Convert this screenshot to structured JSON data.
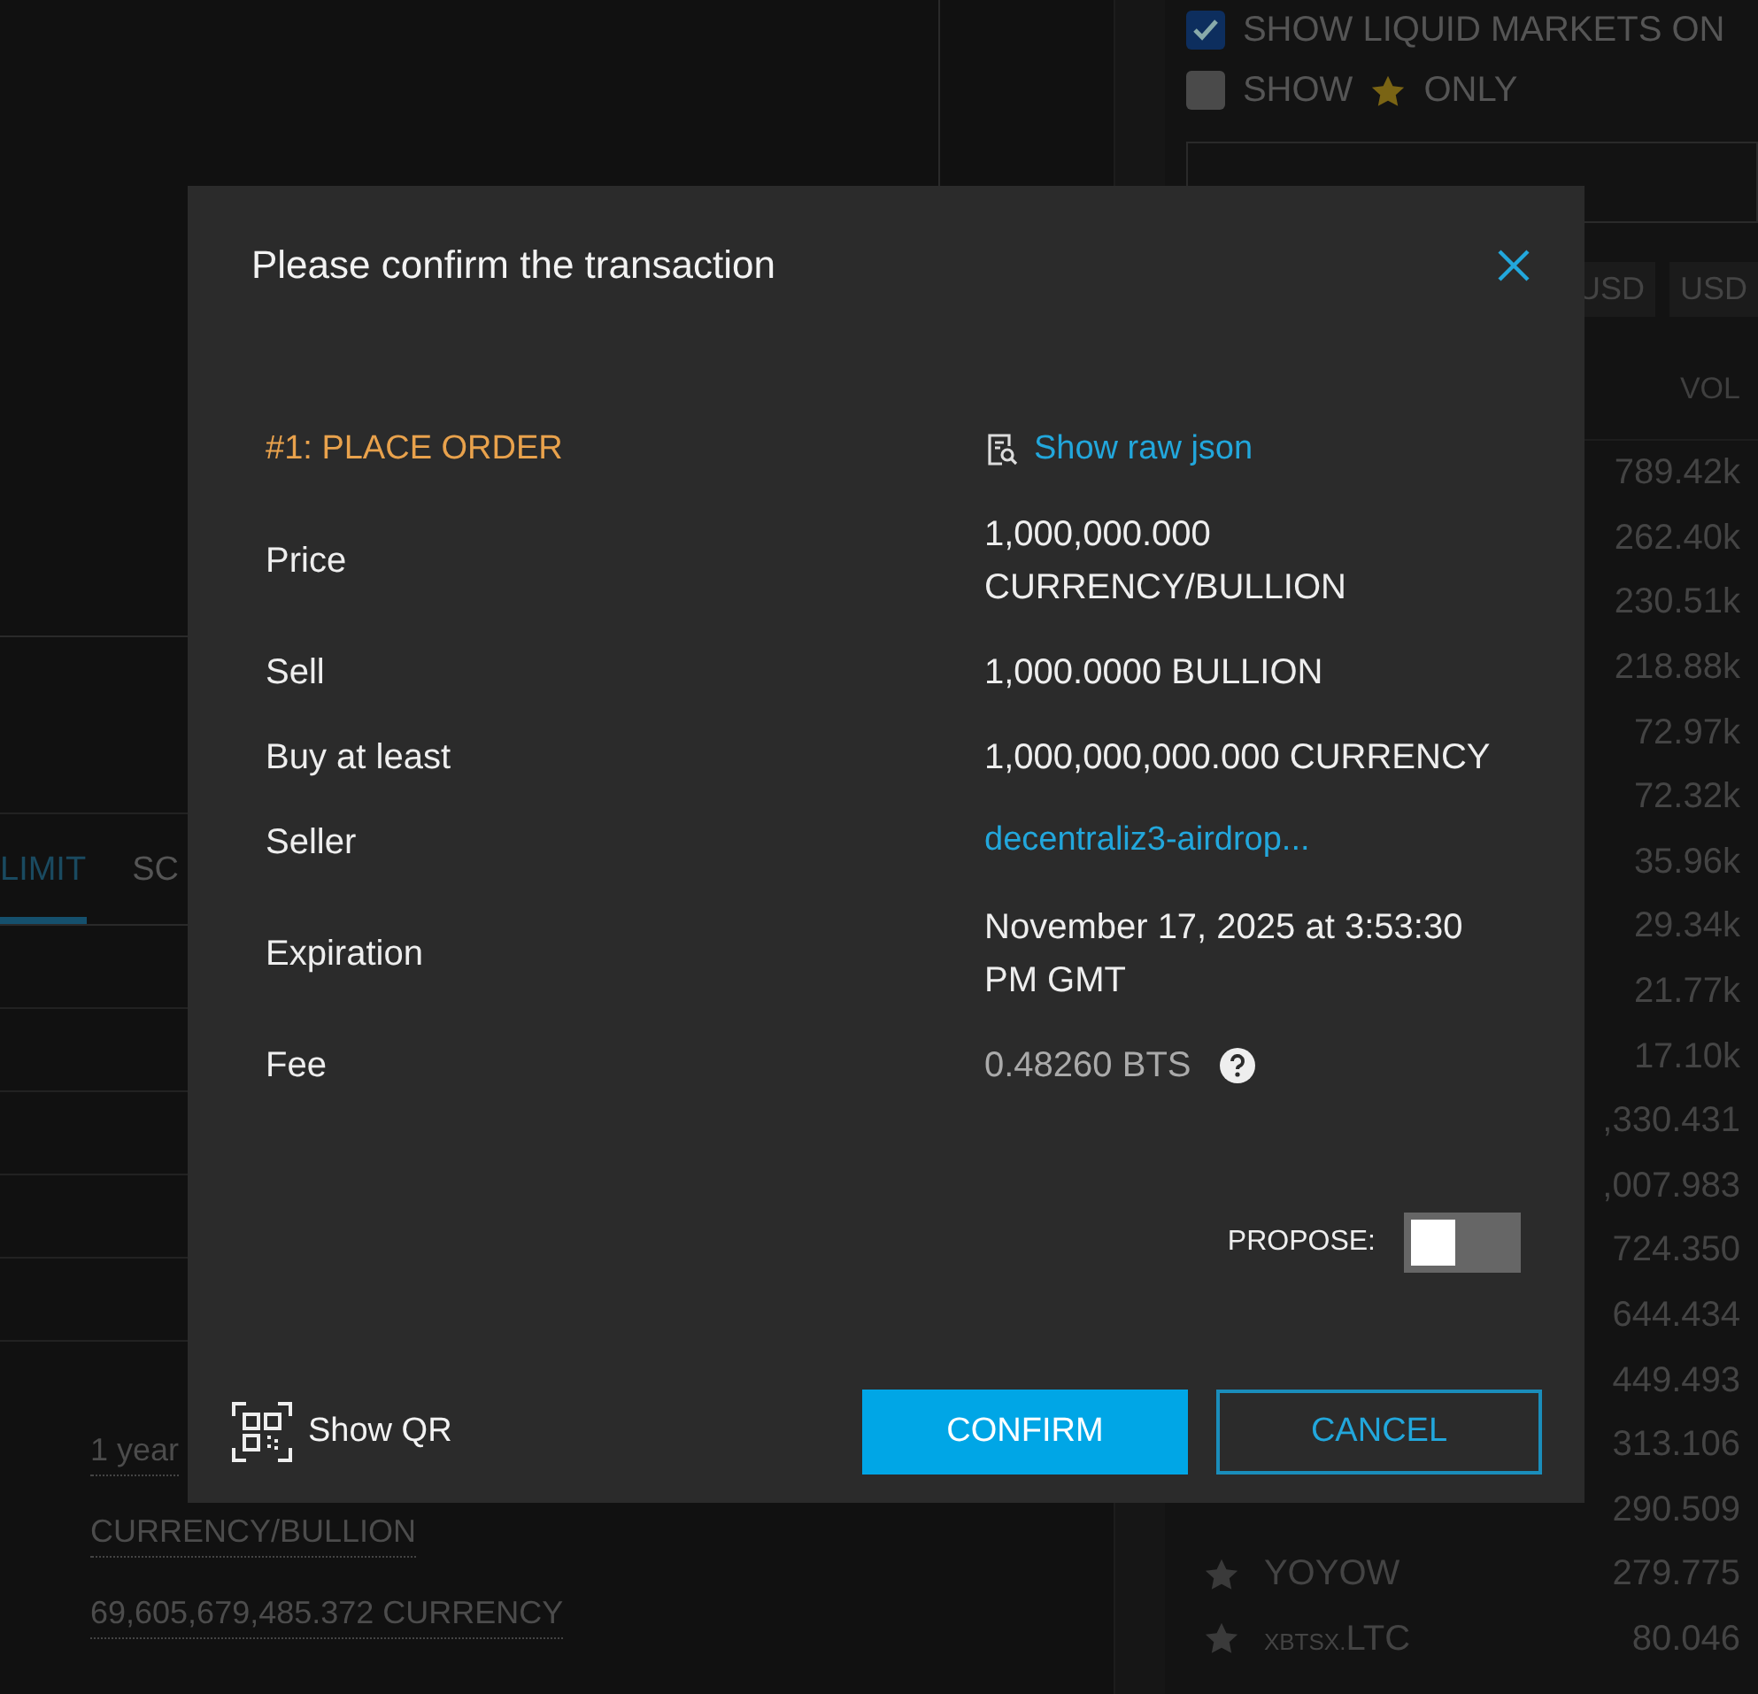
{
  "background": {
    "filters": [
      {
        "kind": "text",
        "label": "SHOW LIQUID MARKETS ON",
        "checked": true
      },
      {
        "kind": "star",
        "label_before": "SHOW",
        "label_after": "ONLY",
        "checked": false
      }
    ],
    "quote_tabs": [
      {
        "label": "USD"
      },
      {
        "label": "USD"
      }
    ],
    "markets": {
      "column": "VOL",
      "rows": [
        {
          "volume": "789.42k"
        },
        {
          "volume": "262.40k"
        },
        {
          "volume": "230.51k"
        },
        {
          "volume": "218.88k"
        },
        {
          "volume": "72.97k"
        },
        {
          "volume": "72.32k"
        },
        {
          "volume": "35.96k"
        },
        {
          "volume": "29.34k"
        },
        {
          "volume": "21.77k"
        },
        {
          "volume": "17.10k"
        },
        {
          "volume": ",330.431"
        },
        {
          "volume": ",007.983"
        },
        {
          "volume": "724.350"
        },
        {
          "volume": "644.434"
        },
        {
          "volume": "449.493"
        },
        {
          "volume": "313.106"
        },
        {
          "volume": "290.509"
        },
        {
          "name": "YOYOW",
          "volume": "279.775",
          "starred": false
        },
        {
          "prefix": "XBTSX.",
          "name": "LTC",
          "volume": "80.046",
          "starred": false
        }
      ]
    },
    "order_tabs": [
      {
        "label": "LIMIT",
        "selected": true
      },
      {
        "label": "SC",
        "selected": false
      }
    ],
    "summary": [
      "1 year",
      "CURRENCY/BULLION",
      "69,605,679,485.372 CURRENCY"
    ]
  },
  "dialog": {
    "title": "Please confirm the transaction",
    "operation": "#1: PLACE ORDER",
    "raw_json_link": "Show raw json",
    "fields": [
      {
        "kind": "text",
        "label": "Price",
        "value": "1,000,000.000 CURRENCY/BULLION"
      },
      {
        "kind": "text",
        "label": "Sell",
        "value": "1,000.0000 BULLION"
      },
      {
        "kind": "text",
        "label": "Buy at least",
        "value": "1,000,000,000.000 CURRENCY"
      },
      {
        "kind": "link",
        "label": "Seller",
        "value": "decentraliz3-airdrop..."
      },
      {
        "kind": "text",
        "label": "Expiration",
        "value": "November 17, 2025 at 3:53:30 PM GMT"
      },
      {
        "kind": "fee",
        "label": "Fee",
        "value": "0.48260 BTS"
      }
    ],
    "propose": {
      "label": "PROPOSE:",
      "on": false
    },
    "show_qr": "Show QR",
    "buttons": [
      {
        "kind": "primary",
        "label": "CONFIRM"
      },
      {
        "kind": "outline",
        "label": "CANCEL"
      }
    ]
  }
}
